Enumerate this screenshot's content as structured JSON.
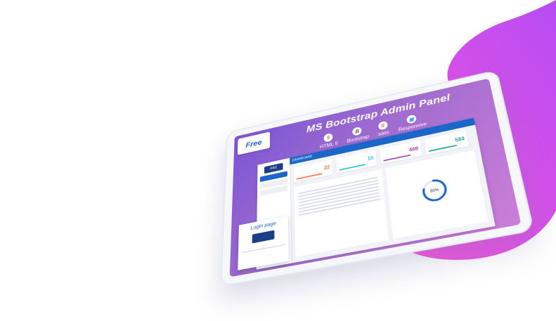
{
  "banner": {
    "free_label": "Free",
    "title": "MS Bootstrap Admin Panel",
    "badges": [
      {
        "icon": "html5-icon",
        "label": "HTML 5",
        "color": "#f06529"
      },
      {
        "icon": "bootstrap-icon",
        "label": "Bootstrap",
        "color": "#563d7c"
      },
      {
        "icon": "sass-icon",
        "label": "sass",
        "color": "#cd6799"
      },
      {
        "icon": "responsive-icon",
        "label": "Responsive",
        "color": "#3b9df2"
      }
    ]
  },
  "admin": {
    "top_label": "DASHBOARD",
    "stats": [
      {
        "value": "22",
        "color": "#ff7043"
      },
      {
        "value": "10",
        "color": "#26c6da"
      },
      {
        "value": "468",
        "color": "#ab47bc"
      },
      {
        "value": "584",
        "color": "#26a69a"
      }
    ],
    "donut_label": "80%",
    "donut_percent": 80,
    "login_title": "Login page"
  },
  "colors": {
    "blob_start": "#ff4fd8",
    "blob_end": "#b445f5",
    "accent": "#1b66c9"
  }
}
